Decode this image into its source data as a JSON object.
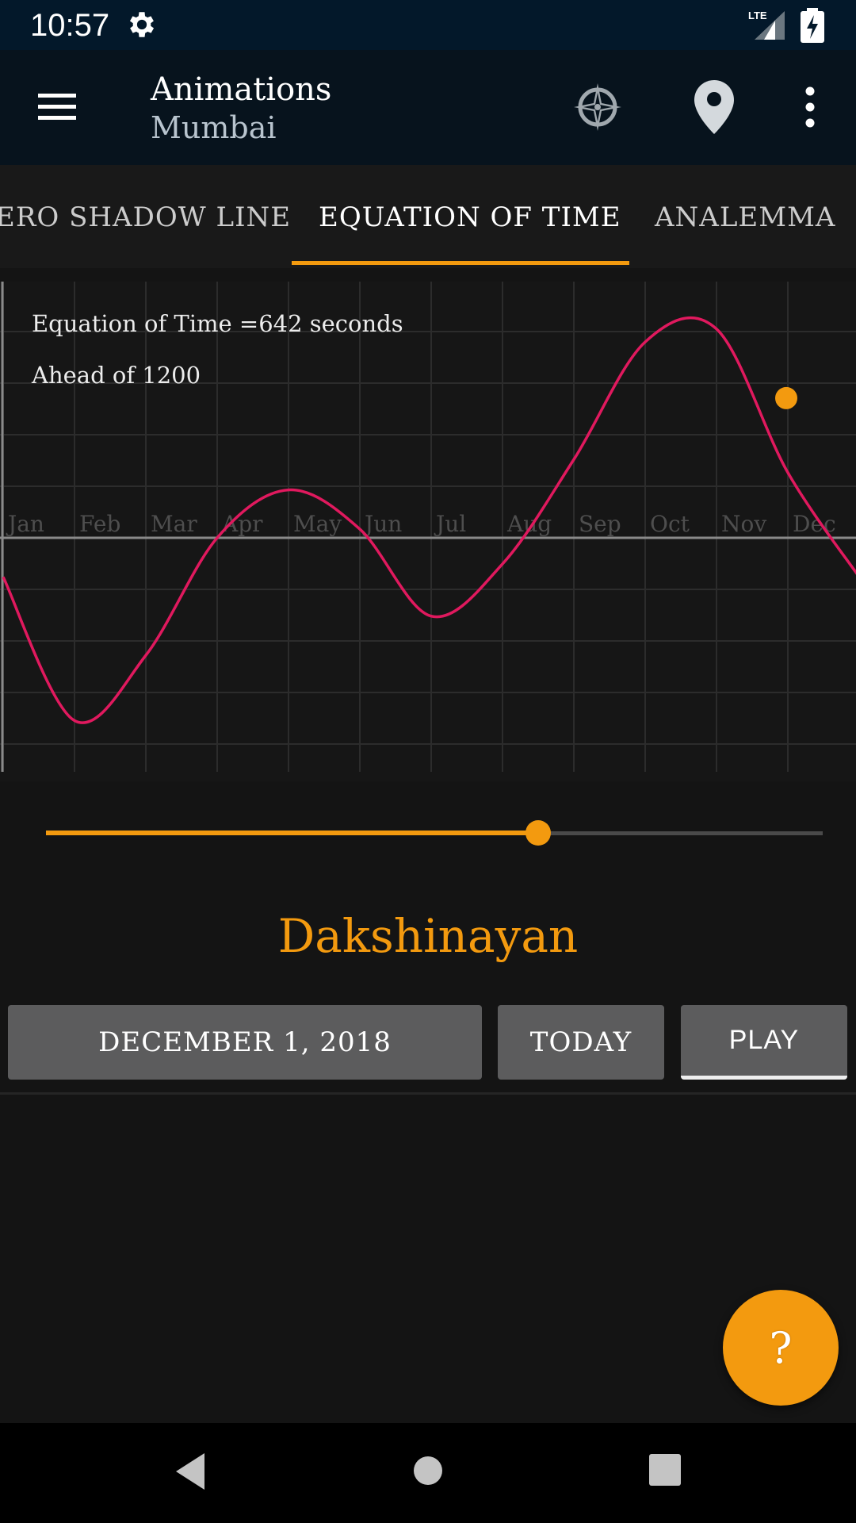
{
  "status_bar": {
    "time": "10:57",
    "network": "LTE",
    "icons": [
      "settings-gear-icon",
      "cell-signal-icon",
      "battery-charging-icon"
    ]
  },
  "app_bar": {
    "title": "Animations",
    "subtitle": "Mumbai",
    "icons": [
      "menu-icon",
      "compass-icon",
      "location-pin-icon",
      "more-vert-icon"
    ]
  },
  "tabs": [
    {
      "label": "ERO SHADOW LINE",
      "active": false
    },
    {
      "label": "EQUATION OF TIME",
      "active": true
    },
    {
      "label": "ANALEMMA",
      "active": false
    }
  ],
  "chart_info": {
    "eot_text": "Equation of Time =642 seconds",
    "ahead_text": "Ahead of 1200"
  },
  "chart_data": {
    "type": "line",
    "x": [
      "Jan",
      "Feb",
      "Mar",
      "Apr",
      "May",
      "Jun",
      "Jul",
      "Aug",
      "Sep",
      "Oct",
      "Nov",
      "Dec"
    ],
    "series": [
      {
        "values": [
          -180,
          -840,
          -540,
          0,
          220,
          40,
          -360,
          -120,
          360,
          900,
          960,
          300
        ]
      }
    ],
    "current_point": {
      "month": "Dec",
      "value": 642
    },
    "ylim": [
      -1140,
      1000
    ],
    "grid": true,
    "colors": {
      "line": "#e0195e",
      "marker": "#f39a0f",
      "axis": "#8a8a8a",
      "grid": "#2c2c2c",
      "tick_label": "#4e4e4e"
    }
  },
  "slider": {
    "value": 0.634
  },
  "season_label": "Dakshinayan",
  "buttons": {
    "date": "DECEMBER 1, 2018",
    "today": "TODAY",
    "play": "PLAY"
  },
  "fab": {
    "label": "?"
  },
  "colors": {
    "accent": "#f39a0f",
    "status_bar": "#03182a",
    "app_bar": "#07131d",
    "background": "#141414",
    "button": "#5c5c5d"
  },
  "nav_bar": {
    "icons": [
      "back-icon",
      "home-icon",
      "recents-icon"
    ]
  }
}
